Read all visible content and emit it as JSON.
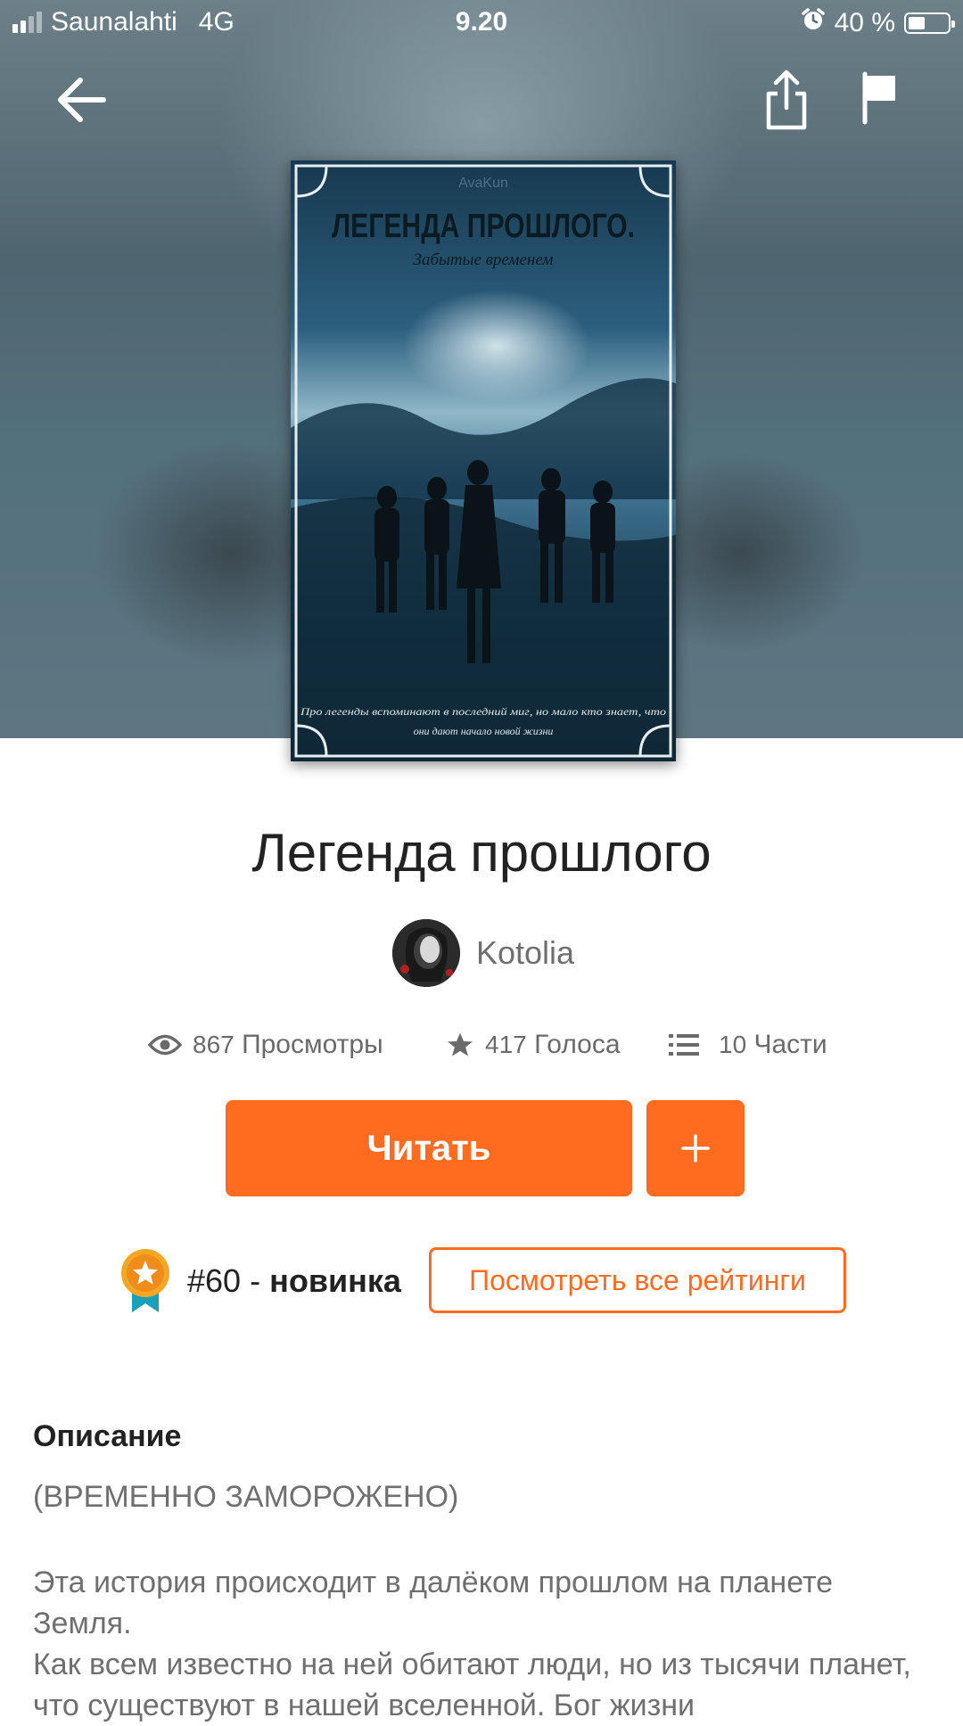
{
  "status_bar": {
    "carrier": "Saunalahti",
    "network": "4G",
    "time": "9.20",
    "battery": "40 %",
    "battery_level": 0.4
  },
  "header": {
    "back_icon": "arrow-left-icon",
    "share_icon": "share-icon",
    "report_icon": "flag-icon"
  },
  "cover": {
    "author_mark": "AvaKun",
    "title": "ЛЕГЕНДА ПРОШЛОГО.",
    "subtitle": "Забытые временем",
    "tagline_line1": "Про легенды вспоминают в последний миг, но мало кто знает, что",
    "tagline_line2": "они дают начало новой жизни"
  },
  "story": {
    "title": "Легенда прошлого",
    "author": "Kotolia"
  },
  "stats": {
    "views_count": "867",
    "views_label": "Просмотры",
    "votes_count": "417",
    "votes_label": "Голоса",
    "parts_count": "10",
    "parts_label": "Части"
  },
  "actions": {
    "read_label": "Читать",
    "add_label": "+"
  },
  "ranking": {
    "rank": "#60",
    "separator": " - ",
    "category": "новинка",
    "view_all_label": "Посмотреть все рейтинги"
  },
  "description": {
    "heading": "Описание",
    "status": "(ВРЕМЕННО ЗАМОРОЖЕНО)",
    "paragraph1": "Эта история происходит в далёком прошлом на планете Земля.",
    "paragraph2": "Как всем известно на ней обитают люди, но из тысячи планет, что существуют в нашей вселенной. Бог жизни"
  },
  "colors": {
    "accent": "#ff6c20",
    "text_primary": "#222222",
    "text_secondary": "#6f6f6f"
  }
}
